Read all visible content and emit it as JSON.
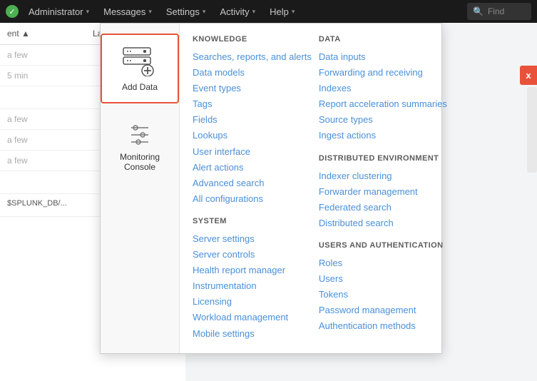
{
  "topnav": {
    "brand_icon": "●",
    "items": [
      {
        "id": "administrator",
        "label": "Administrator",
        "has_caret": true
      },
      {
        "id": "messages",
        "label": "Messages",
        "has_caret": true
      },
      {
        "id": "settings",
        "label": "Settings",
        "has_caret": true
      },
      {
        "id": "activity",
        "label": "Activity",
        "has_caret": true
      },
      {
        "id": "help",
        "label": "Help",
        "has_caret": true
      }
    ],
    "search_placeholder": "Find"
  },
  "sidebar": {
    "items": [
      {
        "id": "add-data",
        "label": "Add Data",
        "selected": true
      },
      {
        "id": "monitoring-console",
        "label": "Monitoring Console",
        "selected": false
      }
    ]
  },
  "knowledge": {
    "header": "KNOWLEDGE",
    "links": [
      "Searches, reports, and alerts",
      "Data models",
      "Event types",
      "Tags",
      "Fields",
      "Lookups",
      "User interface",
      "Alert actions",
      "Advanced search",
      "All configurations"
    ]
  },
  "system": {
    "header": "SYSTEM",
    "links": [
      "Server settings",
      "Server controls",
      "Health report manager",
      "Instrumentation",
      "Licensing",
      "Workload management",
      "Mobile settings"
    ]
  },
  "data": {
    "header": "DATA",
    "links": [
      "Data inputs",
      "Forwarding and receiving",
      "Indexes",
      "Report acceleration summaries",
      "Source types",
      "Ingest actions"
    ]
  },
  "distributed": {
    "header": "DISTRIBUTED ENVIRONMENT",
    "links": [
      "Indexer clustering",
      "Forwarder management",
      "Federated search",
      "Distributed search"
    ]
  },
  "users_auth": {
    "header": "USERS AND AUTHENTICATION",
    "links": [
      "Roles",
      "Users",
      "Tokens",
      "Password management",
      "Authentication methods"
    ]
  },
  "bg_table": {
    "col1": "ent",
    "col2": "Lates",
    "rows": [
      {
        "c1": "",
        "c2": "a few"
      },
      {
        "c1": "",
        "c2": "5 min"
      },
      {
        "c1": "",
        "c2": ""
      },
      {
        "c1": "",
        "c2": "a few"
      },
      {
        "c1": "",
        "c2": "a few"
      },
      {
        "c1": "",
        "c2": "a few"
      }
    ]
  }
}
